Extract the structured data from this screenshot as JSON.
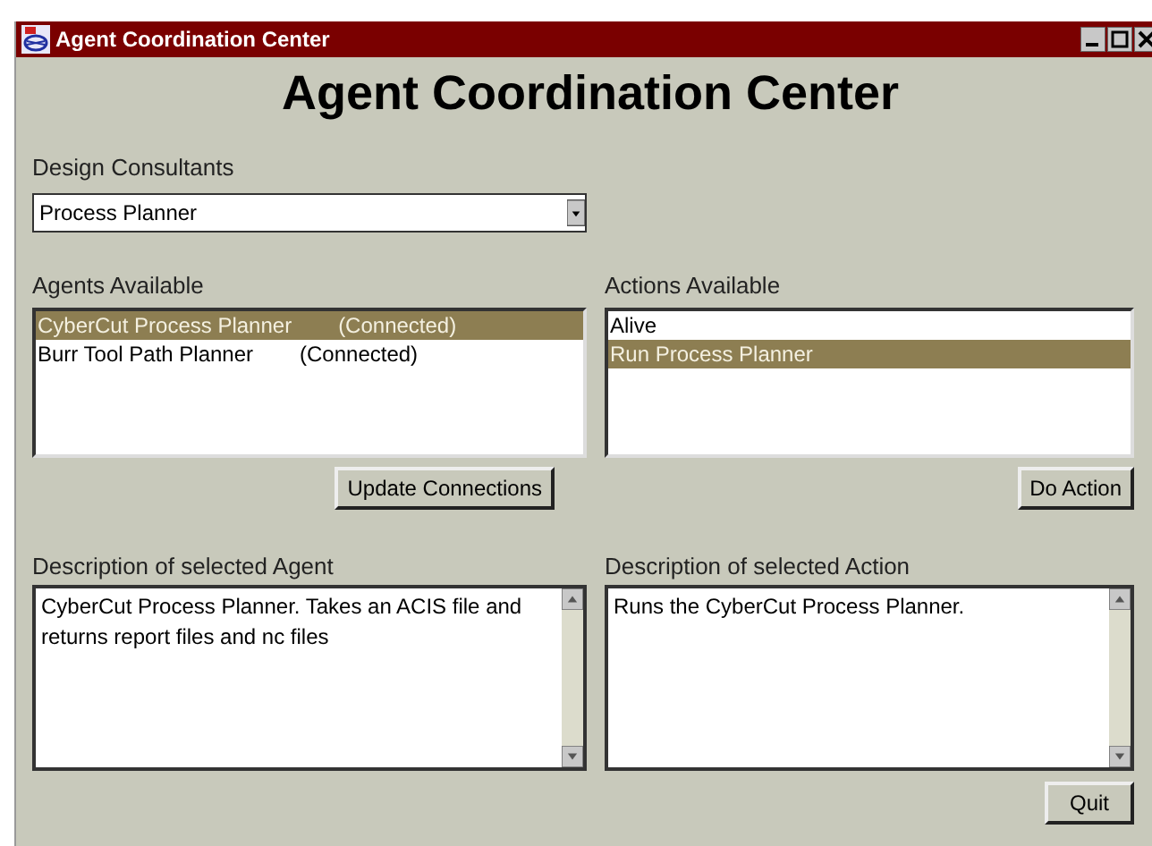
{
  "window": {
    "title": "Agent Coordination Center"
  },
  "heading": "Agent Coordination Center",
  "design_consultants": {
    "label": "Design Consultants",
    "value": "Process Planner"
  },
  "agents": {
    "label": "Agents Available",
    "items": [
      {
        "name": "CyberCut Process Planner",
        "status": "(Connected)",
        "selected": true
      },
      {
        "name": "Burr Tool Path Planner",
        "status": "(Connected)",
        "selected": false
      }
    ],
    "button": "Update Connections"
  },
  "actions": {
    "label": "Actions Available",
    "items": [
      {
        "name": "Alive",
        "selected": false
      },
      {
        "name": "Run Process Planner",
        "selected": true
      }
    ],
    "button": "Do Action"
  },
  "agent_description": {
    "label": "Description of selected Agent",
    "text": "CyberCut Process Planner. Takes an ACIS file and returns report files and nc files"
  },
  "action_description": {
    "label": "Description of selected Action",
    "text": "Runs the CyberCut Process Planner."
  },
  "quit_button": "Quit"
}
